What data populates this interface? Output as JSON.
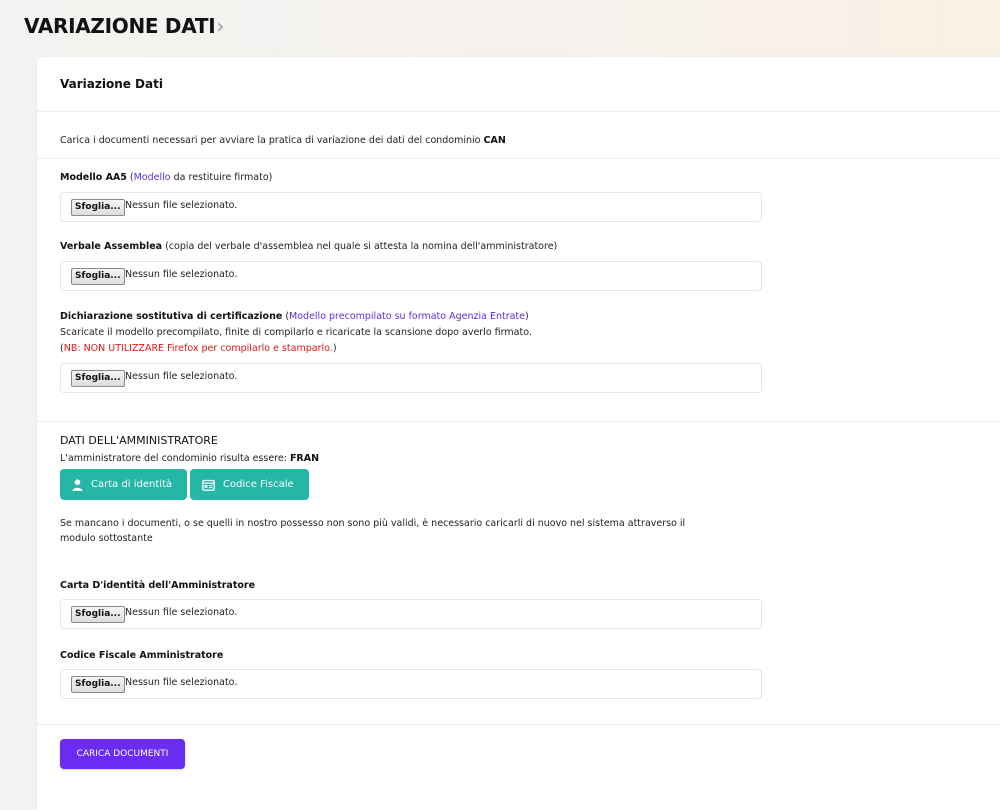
{
  "header": {
    "title": "VARIAZIONE DATI",
    "chevron": "›"
  },
  "card": {
    "title": "Variazione Dati",
    "intro_text": "Carica i documenti necessari per avviare la pratica di variazione dei dati del condominio",
    "intro_code": "CAN"
  },
  "file_default": {
    "browse_label": "Sfoglia...",
    "no_file": "Nessun file selezionato."
  },
  "fields": {
    "aa5": {
      "label": "Modello AA5",
      "open": " (",
      "link": "Modello",
      "suffix": " da restituire firmato)"
    },
    "verbale": {
      "label": "Verbale Assemblea",
      "suffix": " (copia del verbale d'assemblea nel quale si attesta la nomina dell'amministratore)"
    },
    "dichiarazione": {
      "label": "Dichiarazione sostitutiva di certificazione",
      "open": " (",
      "link": "Modello precompilato su formato Agenzia Entrate",
      "close": ")",
      "line2": "Scaricate il modello precompilato, finite di compilarlo e ricaricate la scansione dopo averlo firmato.",
      "note_open": "(",
      "note": "NB: NON UTILIZZARE Firefox per compilarlo e stamparlo.",
      "note_close": ")"
    },
    "carta_admin": {
      "label": "Carta D'identità dell'Amministratore"
    },
    "cf_admin": {
      "label": "Codice Fiscale Amministratore"
    }
  },
  "admin": {
    "heading": "DATI DELL'AMMINISTRATORE",
    "line": "L'amministratore del condominio risulta essere:",
    "name": "FRAN",
    "btn_id": "Carta di identità",
    "btn_cf": "Codice Fiscale",
    "notice_line1": "Se mancano i documenti, o se quelli in nostro possesso non sono più validi, è necessario caricarli di nuovo nel sistema attraverso il",
    "notice_line2": "modulo sottostante"
  },
  "submit": {
    "label": "CARICA DOCUMENTI"
  },
  "colors": {
    "accent": "#6a2cf0",
    "teal": "#25b7a6",
    "link": "#5b2ee0",
    "warning": "#e01818"
  },
  "icons": {
    "id_button": "user-icon",
    "cf_button": "id-card-icon",
    "header": "chevron-right-icon"
  }
}
